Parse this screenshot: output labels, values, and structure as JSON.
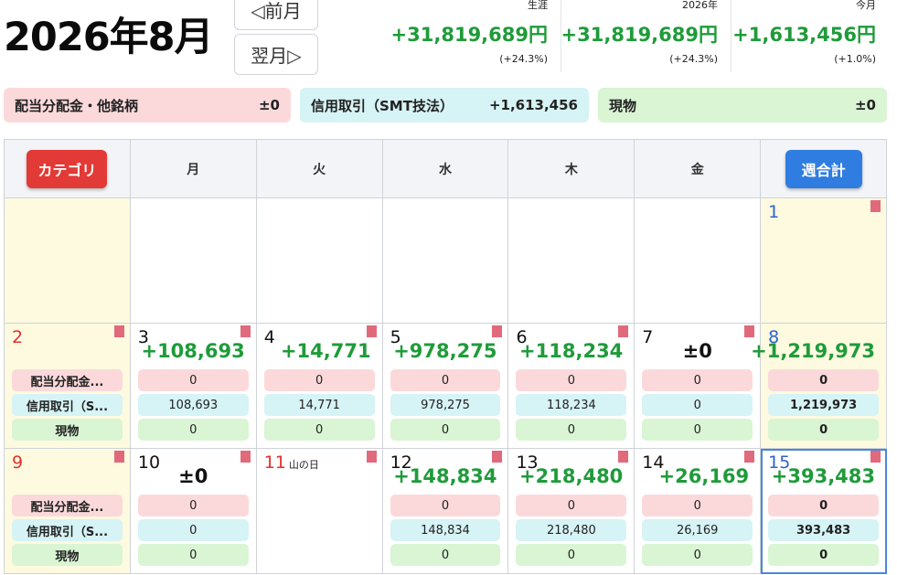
{
  "header": {
    "title": "2026年8月",
    "prev_label": "◁前月",
    "next_label": "翌月▷"
  },
  "stats": [
    {
      "label": "生涯",
      "value": "+31,819,689円",
      "pct": "(+24.3%)"
    },
    {
      "label": "2026年",
      "value": "+31,819,689円",
      "pct": "(+24.3%)"
    },
    {
      "label": "今月",
      "value": "+1,613,456円",
      "pct": "(+1.0%)"
    }
  ],
  "categories": [
    {
      "name": "配当分配金・他銘柄",
      "value": "±0",
      "color": "#fbd9db"
    },
    {
      "name": "信用取引（SMT技法）",
      "value": "+1,613,456",
      "color": "#d6f3f5"
    },
    {
      "name": "現物",
      "value": "±0",
      "color": "#d9f5d4"
    }
  ],
  "calendar": {
    "category_button": "カテゴリ",
    "weekly_total_button": "週合計",
    "weekdays": [
      "月",
      "火",
      "水",
      "木",
      "金"
    ],
    "row_labels": [
      "配当分配金...",
      "信用取引（S...",
      "現物"
    ],
    "week1": {
      "day1": "1"
    },
    "week2": {
      "label_day": "2",
      "days": [
        {
          "day": "3",
          "total": "+108,693",
          "v1": "0",
          "v2": "108,693",
          "v3": "0"
        },
        {
          "day": "4",
          "total": "+14,771",
          "v1": "0",
          "v2": "14,771",
          "v3": "0"
        },
        {
          "day": "5",
          "total": "+978,275",
          "v1": "0",
          "v2": "978,275",
          "v3": "0"
        },
        {
          "day": "6",
          "total": "+118,234",
          "v1": "0",
          "v2": "118,234",
          "v3": "0"
        },
        {
          "day": "7",
          "total": "±0",
          "v1": "0",
          "v2": "0",
          "v3": "0"
        }
      ],
      "week_total": {
        "day": "8",
        "total": "+1,219,973",
        "v1": "0",
        "v2": "1,219,973",
        "v3": "0"
      }
    },
    "week3": {
      "label_day": "9",
      "days": [
        {
          "day": "10",
          "total": "±0",
          "v1": "0",
          "v2": "0",
          "v3": "0"
        },
        {
          "day": "11",
          "holiday": "山の日"
        },
        {
          "day": "12",
          "total": "+148,834",
          "v1": "0",
          "v2": "148,834",
          "v3": "0"
        },
        {
          "day": "13",
          "total": "+218,480",
          "v1": "0",
          "v2": "218,480",
          "v3": "0"
        },
        {
          "day": "14",
          "total": "+26,169",
          "v1": "0",
          "v2": "26,169",
          "v3": "0"
        }
      ],
      "week_total": {
        "day": "15",
        "total": "+393,483",
        "v1": "0",
        "v2": "393,483",
        "v3": "0"
      }
    }
  },
  "colors": {
    "positive": "#1f9b3a",
    "accent_red": "#e23a36",
    "accent_blue": "#2f7de1"
  }
}
